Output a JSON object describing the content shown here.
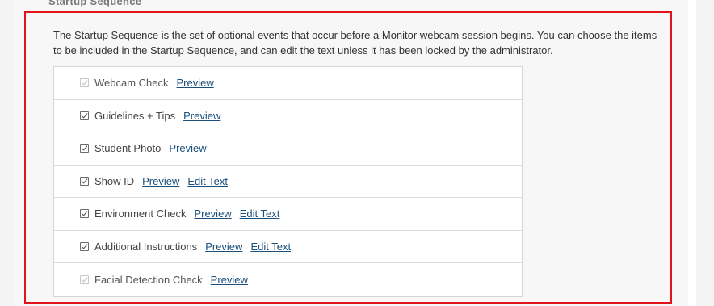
{
  "section": {
    "heading": "Startup Sequence",
    "description": "The Startup Sequence is the set of optional events that occur before a Monitor webcam session begins. You can choose the items to be included in the Startup Sequence, and can edit the text unless it has been locked by the administrator."
  },
  "items": [
    {
      "label": "Webcam Check",
      "checked": true,
      "locked": true,
      "preview": "Preview",
      "edit": null
    },
    {
      "label": "Guidelines + Tips",
      "checked": true,
      "locked": false,
      "preview": "Preview",
      "edit": null
    },
    {
      "label": "Student Photo",
      "checked": true,
      "locked": false,
      "preview": "Preview",
      "edit": null
    },
    {
      "label": "Show ID",
      "checked": true,
      "locked": false,
      "preview": "Preview",
      "edit": "Edit Text"
    },
    {
      "label": "Environment Check",
      "checked": true,
      "locked": false,
      "preview": "Preview",
      "edit": "Edit Text"
    },
    {
      "label": "Additional Instructions",
      "checked": true,
      "locked": false,
      "preview": "Preview",
      "edit": "Edit Text"
    },
    {
      "label": "Facial Detection Check",
      "checked": true,
      "locked": true,
      "preview": "Preview",
      "edit": null
    }
  ],
  "colors": {
    "highlight_border": "#e1131b",
    "link": "#1b4f7c"
  },
  "icons": {
    "checkbox": "check-icon"
  }
}
